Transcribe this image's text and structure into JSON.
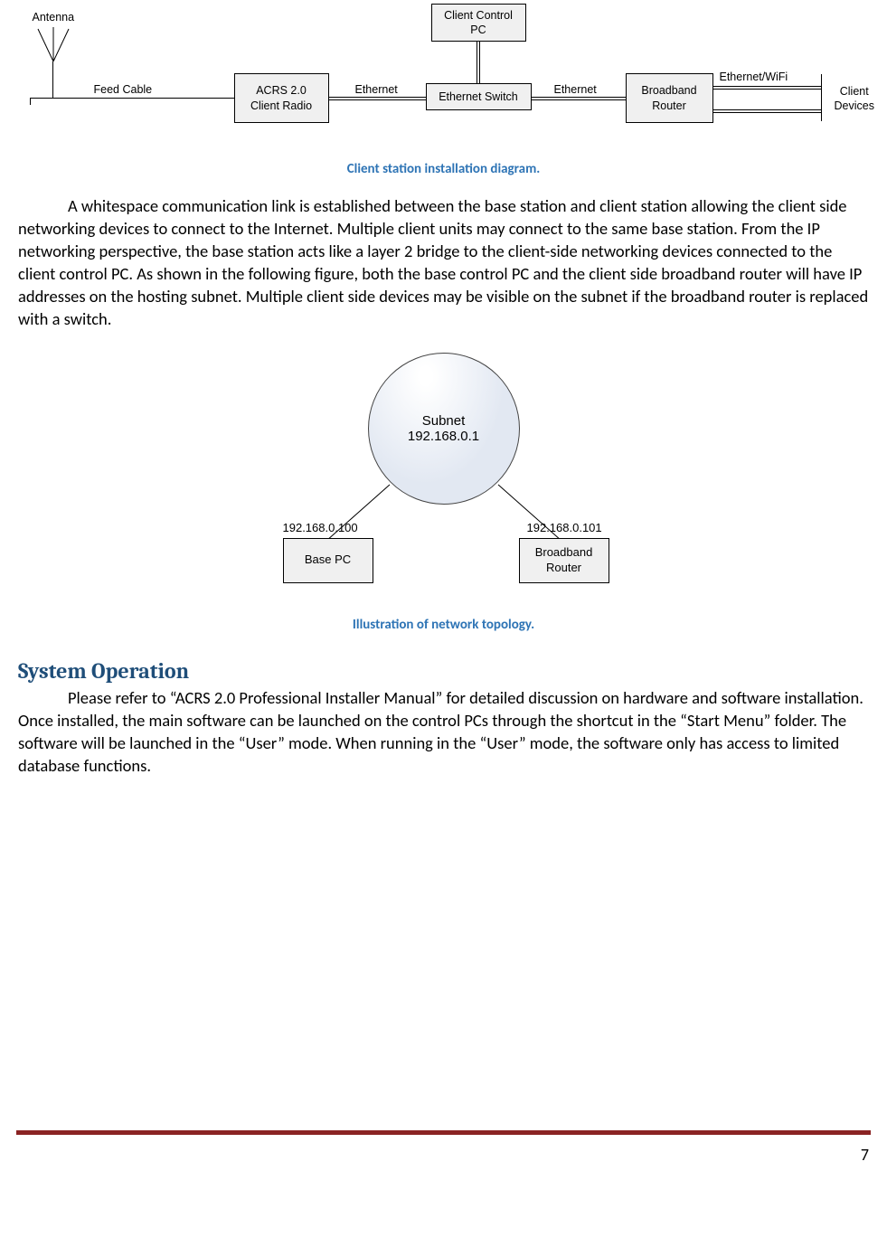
{
  "diagram1": {
    "antenna": "Antenna",
    "feed_cable": "Feed Cable",
    "acrs": "ACRS 2.0\nClient Radio",
    "ethernet1": "Ethernet",
    "switch": "Ethernet Switch",
    "client_control_pc": "Client Control\nPC",
    "ethernet2": "Ethernet",
    "broadband": "Broadband\nRouter",
    "ethernet_wifi": "Ethernet/WiFi",
    "client_devices": "Client\nDevices"
  },
  "caption1": "Client station installation diagram.",
  "para1": "A whitespace communication link is established between the base station and client station allowing the client side networking devices to connect to the Internet. Multiple client units may connect to the same base station. From the IP networking perspective, the base station acts like a layer 2 bridge to the client-side networking devices connected to the client control PC. As shown in the following figure, both the base control PC and the client side broadband router will have IP addresses on the hosting subnet. Multiple client side devices may be visible on the subnet if the broadband router is replaced with a switch.",
  "diagram2": {
    "subnet_label": "Subnet",
    "subnet_ip": "192.168.0.1",
    "base_ip": "192.168.0.100",
    "base_label": "Base PC",
    "router_ip": "192.168.0.101",
    "router_label": "Broadband\nRouter"
  },
  "caption2": "Illustration of network topology.",
  "heading1": "System Operation",
  "para2": "Please refer to “ACRS 2.0 Professional Installer Manual” for detailed discussion on hardware and software installation. Once installed, the main software can be launched on the control PCs through the shortcut in the “Start Menu” folder. The software will be launched in the “User” mode. When running in the “User” mode, the software only has access to limited database functions.",
  "page_number": "7"
}
